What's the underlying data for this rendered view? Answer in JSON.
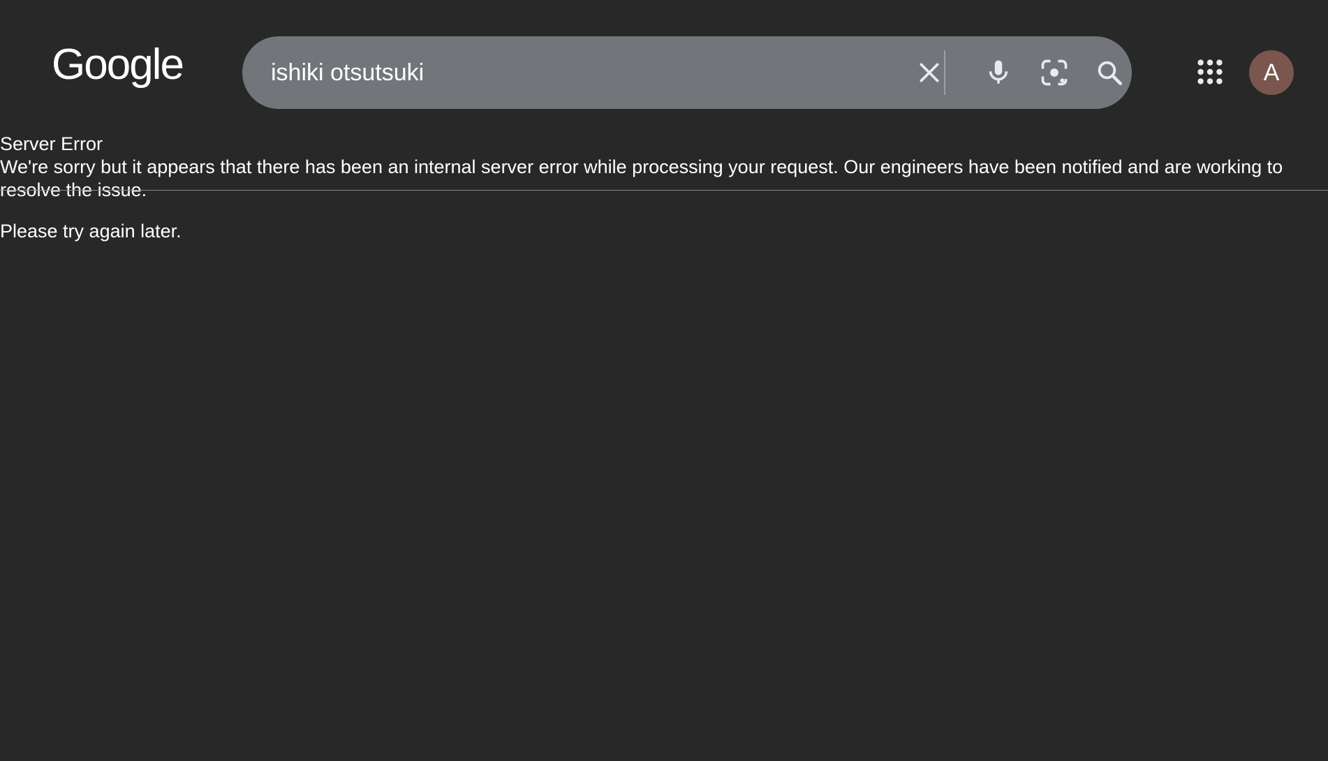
{
  "header": {
    "logo_text": "Google",
    "search": {
      "value": "ishiki otsutsuki"
    },
    "icons": {
      "clear": "close-icon",
      "voice": "microphone-icon",
      "lens": "camera-lens-icon",
      "search": "search-icon",
      "apps": "apps-grid-icon"
    },
    "avatar": {
      "initial": "A",
      "color": "#7a564e"
    }
  },
  "error": {
    "title": "Server Error",
    "message": "We're sorry but it appears that there has been an internal server error while processing your request. Our engineers have been notified and are working to resolve the issue.",
    "retry": "Please try again later."
  },
  "colors": {
    "background": "#282828",
    "searchbar": "#72767a",
    "text": "#ffffff"
  }
}
